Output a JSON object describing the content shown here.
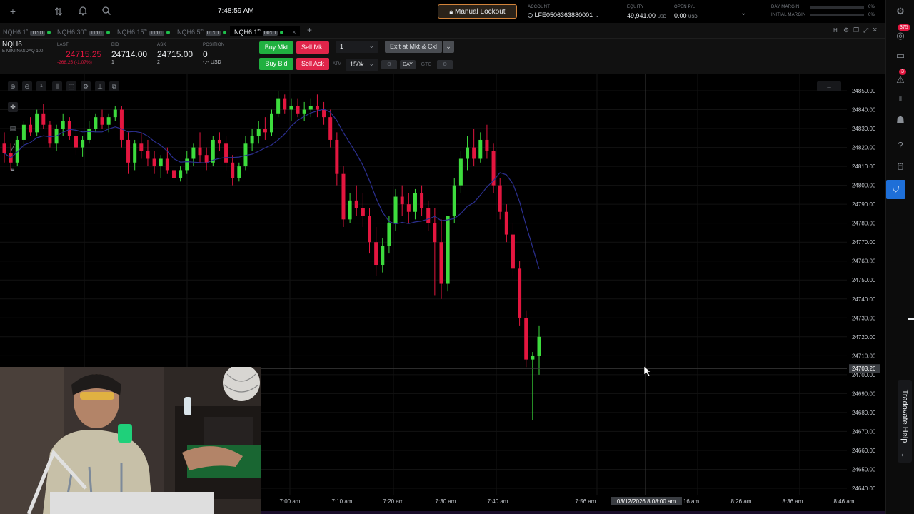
{
  "topbar": {
    "time": "7:48:59 AM",
    "lockout_label": "Manual Lockout",
    "account_label": "ACCOUNT",
    "account_value": "LFE0506363880001",
    "equity_label": "EQUITY",
    "equity_value": "49,941.00",
    "equity_ccy": "USD",
    "openpl_label": "OPEN P/L",
    "openpl_value": "0.00",
    "openpl_ccy": "USD",
    "day_margin_label": "DAY MARGIN",
    "day_margin_value": "0%",
    "initial_margin_label": "INITIAL MARGIN",
    "initial_margin_value": "0%"
  },
  "tabs": [
    {
      "label": "NQH6 1",
      "sup": "h",
      "tf": "11:01"
    },
    {
      "label": "NQH6 30",
      "sup": "m",
      "tf": "11:01"
    },
    {
      "label": "NQH6 15",
      "sup": "m",
      "tf": "11:01"
    },
    {
      "label": "NQH6 5",
      "sup": "m",
      "tf": "01:01"
    },
    {
      "label": "NQH6 1",
      "sup": "m",
      "tf": "00:01"
    }
  ],
  "quote": {
    "symbol": "NQH6",
    "symbol_desc": "E-MINI NASDAQ 100",
    "last_label": "LAST",
    "last_value": "24715.25",
    "last_change": "-268.25 (-1.07%)",
    "bid_label": "BID",
    "bid_value": "24714.00",
    "bid_size": "1",
    "ask_label": "ASK",
    "ask_value": "24715.00",
    "ask_size": "2",
    "position_label": "POSITION",
    "position_value": "0",
    "position_sub": "-.-- USD"
  },
  "order": {
    "buy_mkt": "Buy Mkt",
    "sell_mkt": "Sell Mkt",
    "buy_bid": "Buy Bid",
    "sell_ask": "Sell Ask",
    "qty": "1",
    "exit_label": "Exit at Mkt & Cxl",
    "atm_label": "ATM",
    "atm_value": "150k",
    "tif_day": "DAY",
    "tif_gtc": "GTC"
  },
  "rail": {
    "badge_top": "375",
    "badge_alert": "3",
    "help_label": "Tradovate Help"
  },
  "chart_data": {
    "type": "candlestick",
    "symbol": "NQH6 1m",
    "ylim": [
      24635,
      24855
    ],
    "y_ticks": [
      "24850.00",
      "24840.00",
      "24830.00",
      "24820.00",
      "24810.00",
      "24800.00",
      "24790.00",
      "24780.00",
      "24770.00",
      "24760.00",
      "24750.00",
      "24740.00",
      "24730.00",
      "24720.00",
      "24710.00",
      "24700.00",
      "24690.00",
      "24680.00",
      "24670.00",
      "24660.00",
      "24650.00",
      "24640.00"
    ],
    "x_ticks": [
      "7:00 am",
      "7:10 am",
      "7:20 am",
      "7:30 am",
      "7:40 am",
      "7:56 am",
      "16 am",
      "8:26 am",
      "8:36 am",
      "8:46 am"
    ],
    "crosshair_price": "24703.26",
    "crosshair_time": "03/12/2026 8:08:00 am",
    "up_color": "#3ddc3d",
    "down_color": "#e3163f",
    "ma_color": "#2b2f8f",
    "candles": [
      [
        24822,
        24828,
        24812,
        24817
      ],
      [
        24817,
        24822,
        24808,
        24812
      ],
      [
        24812,
        24826,
        24810,
        24824
      ],
      [
        24824,
        24834,
        24820,
        24832
      ],
      [
        24832,
        24836,
        24826,
        24828
      ],
      [
        24828,
        24840,
        24826,
        24838
      ],
      [
        24838,
        24843,
        24830,
        24832
      ],
      [
        24832,
        24834,
        24820,
        24822
      ],
      [
        24822,
        24832,
        24818,
        24830
      ],
      [
        24830,
        24838,
        24826,
        24834
      ],
      [
        24834,
        24836,
        24824,
        24826
      ],
      [
        24826,
        24830,
        24816,
        24820
      ],
      [
        24820,
        24826,
        24815,
        24824
      ],
      [
        24824,
        24834,
        24822,
        24830
      ],
      [
        24830,
        24838,
        24828,
        24836
      ],
      [
        24836,
        24840,
        24830,
        24832
      ],
      [
        24832,
        24838,
        24828,
        24836
      ],
      [
        24836,
        24842,
        24834,
        24840
      ],
      [
        24840,
        24842,
        24820,
        24824
      ],
      [
        24824,
        24828,
        24806,
        24812
      ],
      [
        24812,
        24824,
        24808,
        24822
      ],
      [
        24822,
        24828,
        24814,
        24818
      ],
      [
        24818,
        24824,
        24810,
        24814
      ],
      [
        24814,
        24818,
        24806,
        24810
      ],
      [
        24810,
        24816,
        24804,
        24814
      ],
      [
        24814,
        24820,
        24806,
        24808
      ],
      [
        24808,
        24814,
        24800,
        24804
      ],
      [
        24804,
        24810,
        24802,
        24808
      ],
      [
        24808,
        24818,
        24806,
        24814
      ],
      [
        24814,
        24822,
        24810,
        24820
      ],
      [
        24820,
        24828,
        24812,
        24816
      ],
      [
        24816,
        24820,
        24808,
        24812
      ],
      [
        24812,
        24826,
        24810,
        24824
      ],
      [
        24824,
        24828,
        24818,
        24822
      ],
      [
        24822,
        24826,
        24808,
        24812
      ],
      [
        24812,
        24816,
        24800,
        24804
      ],
      [
        24804,
        24812,
        24802,
        24810
      ],
      [
        24810,
        24826,
        24808,
        24822
      ],
      [
        24822,
        24830,
        24818,
        24826
      ],
      [
        24826,
        24834,
        24822,
        24830
      ],
      [
        24830,
        24836,
        24824,
        24828
      ],
      [
        24828,
        24840,
        24826,
        24838
      ],
      [
        24838,
        24850,
        24836,
        24846
      ],
      [
        24846,
        24848,
        24838,
        24840
      ],
      [
        24840,
        24846,
        24834,
        24842
      ],
      [
        24842,
        24846,
        24836,
        24838
      ],
      [
        24838,
        24844,
        24834,
        24840
      ],
      [
        24840,
        24846,
        24836,
        24842
      ],
      [
        24842,
        24848,
        24836,
        24840
      ],
      [
        24840,
        24844,
        24832,
        24836
      ],
      [
        24836,
        24840,
        24820,
        24824
      ],
      [
        24824,
        24828,
        24800,
        24806
      ],
      [
        24806,
        24810,
        24778,
        24782
      ],
      [
        24782,
        24796,
        24780,
        24792
      ],
      [
        24792,
        24800,
        24784,
        24788
      ],
      [
        24788,
        24796,
        24778,
        24784
      ],
      [
        24784,
        24788,
        24764,
        24770
      ],
      [
        24770,
        24778,
        24752,
        24758
      ],
      [
        24758,
        24772,
        24754,
        24768
      ],
      [
        24768,
        24784,
        24764,
        24780
      ],
      [
        24780,
        24798,
        24776,
        24794
      ],
      [
        24794,
        24800,
        24784,
        24790
      ],
      [
        24790,
        24796,
        24780,
        24786
      ],
      [
        24786,
        24798,
        24782,
        24796
      ],
      [
        24796,
        24800,
        24784,
        24788
      ],
      [
        24788,
        24792,
        24776,
        24780
      ],
      [
        24780,
        24788,
        24742,
        24770
      ],
      [
        24770,
        24782,
        24740,
        24748
      ],
      [
        24748,
        24770,
        24744,
        24784
      ],
      [
        24784,
        24804,
        24780,
        24800
      ],
      [
        24800,
        24818,
        24796,
        24814
      ],
      [
        24814,
        24826,
        24808,
        24820
      ],
      [
        24820,
        24830,
        24810,
        24814
      ],
      [
        24814,
        24828,
        24812,
        24824
      ],
      [
        24824,
        24832,
        24814,
        24818
      ],
      [
        24818,
        24822,
        24796,
        24800
      ],
      [
        24800,
        24804,
        24782,
        24786
      ],
      [
        24786,
        24790,
        24770,
        24774
      ],
      [
        24774,
        24780,
        24752,
        24756
      ],
      [
        24756,
        24760,
        24726,
        24730
      ],
      [
        24730,
        24734,
        24704,
        24708
      ],
      [
        24708,
        24712,
        24676,
        24710
      ],
      [
        24710,
        24726,
        24700,
        24720
      ]
    ]
  }
}
